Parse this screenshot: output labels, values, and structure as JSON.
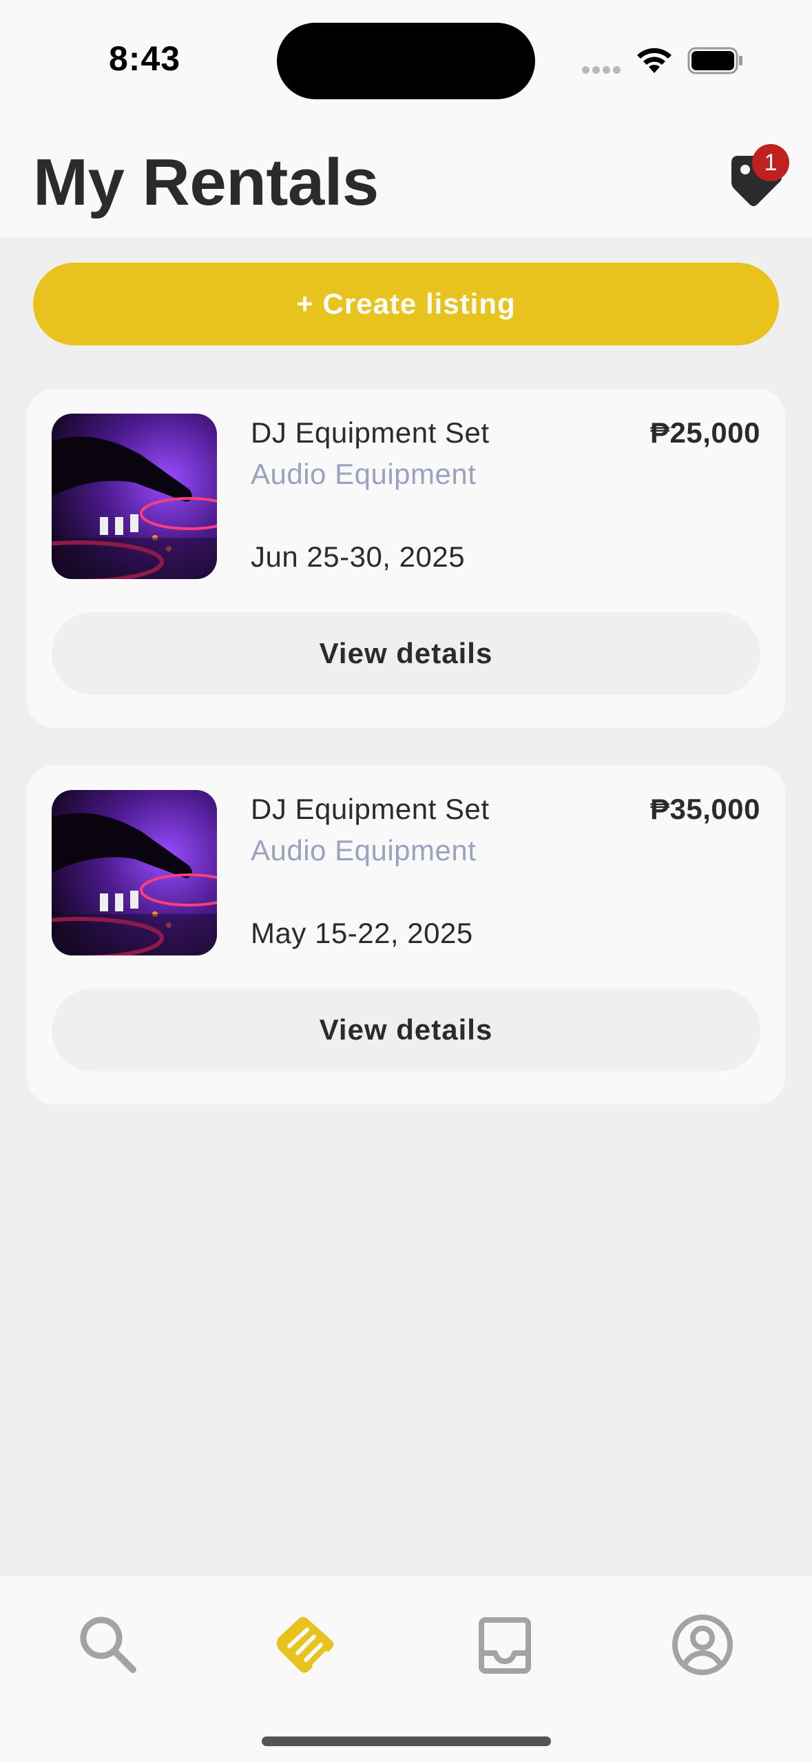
{
  "status_bar": {
    "time": "8:43"
  },
  "header": {
    "title": "My Rentals",
    "notification_count": "1"
  },
  "create_button": {
    "label": "+ Create listing"
  },
  "rentals": [
    {
      "title": "DJ Equipment Set",
      "category": "Audio Equipment",
      "dates": "Jun 25-30, 2025",
      "price": "₱25,000",
      "button_label": "View details",
      "image": "dj-mixer-photo"
    },
    {
      "title": "DJ Equipment Set",
      "category": "Audio Equipment",
      "dates": "May 15-22, 2025",
      "price": "₱35,000",
      "button_label": "View details",
      "image": "dj-mixer-photo"
    }
  ],
  "tab_bar": {
    "tabs": [
      {
        "icon": "search-icon",
        "active": false
      },
      {
        "icon": "handshake-icon",
        "active": true
      },
      {
        "icon": "inbox-icon",
        "active": false
      },
      {
        "icon": "profile-icon",
        "active": false
      }
    ],
    "active_color": "#e8c21d",
    "inactive_color": "#a3a3a3"
  },
  "colors": {
    "accent": "#e8c21d",
    "badge": "#c0201f",
    "category_text": "#9aa2bf"
  }
}
